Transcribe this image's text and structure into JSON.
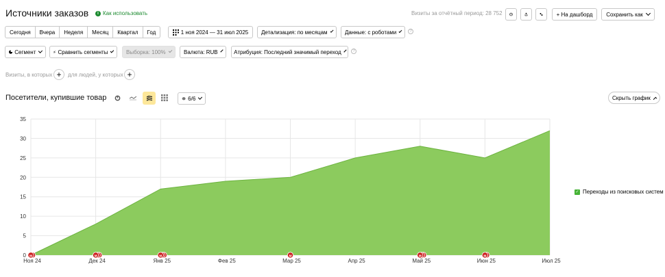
{
  "header": {
    "title": "Источники заказов",
    "howto": "Как использовать",
    "visits_label": "Визиты за отчётный период: 28 752",
    "buttons": {
      "history_icon": "clock-icon",
      "export_icon": "export-icon",
      "share_icon": "share-icon",
      "dashboard": "+ На дашборд",
      "save_as": "Сохранить как"
    }
  },
  "period_tabs": [
    "Сегодня",
    "Вчера",
    "Неделя",
    "Месяц",
    "Квартал",
    "Год"
  ],
  "date_range": "1 ноя 2024 — 31 июл 2025",
  "detail": "Детализация: по месяцам",
  "data_mode": "Данные: с роботами",
  "filters": {
    "segment": "Сегмент",
    "compare": "Сравнить сегменты",
    "sample": "Выборка: 100%",
    "currency": "Валюта: RUB",
    "attribution": "Атрибуция: Последний значимый переход"
  },
  "conditions": {
    "visits_where": "Визиты, в которых",
    "people_where": "для людей, у которых"
  },
  "chart_section": {
    "title": "Посетители, купившие товар",
    "series_count": "6/6",
    "hide_chart": "Скрыть график",
    "colors": {
      "area": "#8ccb5e",
      "line": "#6cb33f",
      "marker": "#cc1f1f"
    }
  },
  "chart_data": {
    "type": "area",
    "x": [
      "Ноя 24",
      "Дек 24",
      "Янв 25",
      "Фев 25",
      "Мар 25",
      "Апр 25",
      "Май 25",
      "Июн 25",
      "Июл 25"
    ],
    "series": [
      {
        "name": "Переходы из поисковых систем",
        "values": [
          0,
          8,
          17,
          19,
          20,
          25,
          28,
          25,
          32
        ]
      }
    ],
    "ylim": [
      0,
      35
    ],
    "yticks": [
      0,
      5,
      10,
      15,
      20,
      25,
      30,
      35
    ],
    "grid": true,
    "legend": "right",
    "markers": [
      {
        "month": "Ноя 24",
        "count": 2
      },
      {
        "month": "Дек 24",
        "count": 3
      },
      {
        "month": "Янв 25",
        "count": 3
      },
      {
        "month": "Мар 25",
        "count": 1
      },
      {
        "month": "Май 25",
        "count": 3
      },
      {
        "month": "Июн 25",
        "count": 2
      }
    ]
  }
}
